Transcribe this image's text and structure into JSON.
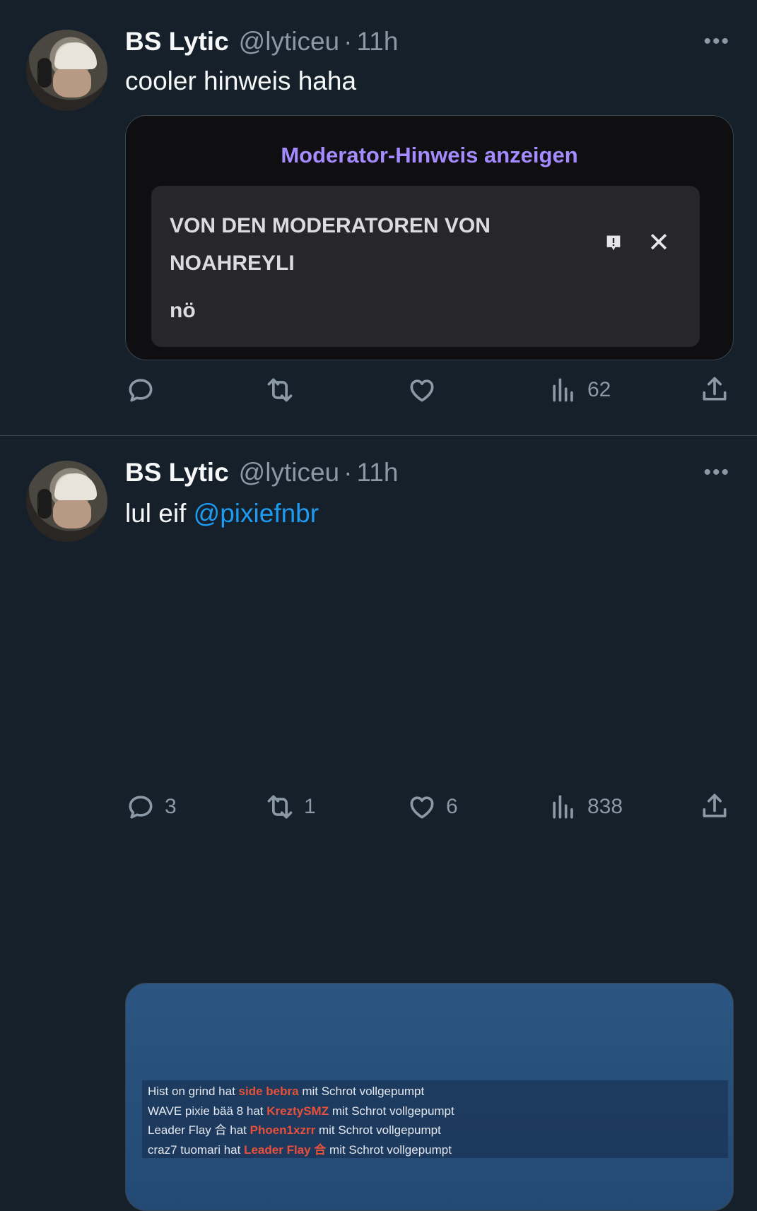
{
  "tweets": [
    {
      "author": "BS Lytic",
      "handle": "@lyticeu",
      "separator": "·",
      "time": "11h",
      "more_label": "•••",
      "text": "cooler hinweis haha",
      "mod_card": {
        "link_label": "Moderator-Hinweis anzeigen",
        "title": "VON DEN MODERATOREN VON NOAHREYLI",
        "body": "nö",
        "close_label": "✕"
      },
      "stats": {
        "replies": "",
        "retweets": "",
        "likes": "",
        "views": "62"
      }
    },
    {
      "author": "BS Lytic",
      "handle": "@lyticeu",
      "separator": "·",
      "time": "11h",
      "more_label": "•••",
      "text": "lul eif",
      "mention": "@pixiefnbr",
      "killfeed": [
        {
          "a": "Hist on grind",
          "verb": "hat",
          "b": "side bebra",
          "rest": "mit Schrot vollgepumpt"
        },
        {
          "a": "WAVE pixie bää 8",
          "verb": "hat",
          "b": "KreztySMZ",
          "rest": "mit Schrot vollgepumpt"
        },
        {
          "a": "Leader Flay 合",
          "verb": "hat",
          "b": "Phoen1xzrr",
          "rest": "mit Schrot vollgepumpt"
        },
        {
          "a": "craz7 tuomari",
          "verb": "hat",
          "b": "Leader Flay 合",
          "rest": "mit Schrot vollgepumpt"
        }
      ],
      "stats": {
        "replies": "3",
        "retweets": "1",
        "likes": "6",
        "views": "838"
      }
    }
  ],
  "colors": {
    "background": "#15202b",
    "accent": "#1d9bf0",
    "muted": "#8b98a5",
    "mod_link": "#a48bff",
    "killfeed_highlight": "#e8503a"
  }
}
